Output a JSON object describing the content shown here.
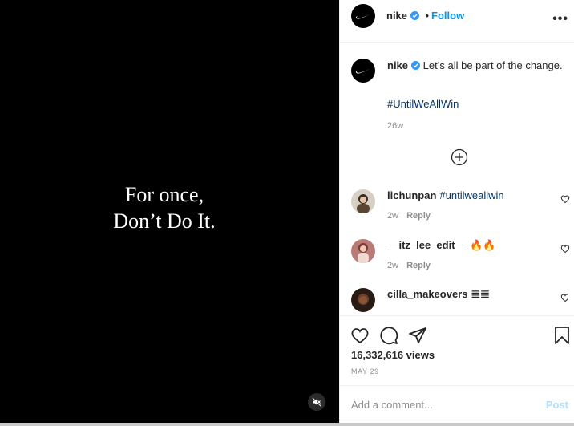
{
  "video": {
    "text_line1": "For once,",
    "text_line2": "Don’t Do It.",
    "mute_icon": "speaker-muted-icon"
  },
  "header": {
    "username": "nike",
    "separator": "•",
    "follow_label": "Follow",
    "more_icon": "more-options-icon",
    "verified_color": "#3897f0"
  },
  "caption": {
    "username": "nike",
    "text": "Let’s all be part of the change.",
    "hashtag": "#UntilWeAllWin",
    "time": "26w",
    "load_more_icon": "plus-circle-icon"
  },
  "comments": [
    {
      "username": "lichunpan",
      "text": "#untilweallwin",
      "time": "2w",
      "reply": "Reply"
    },
    {
      "username": "__itz_lee_edit__",
      "text": "🔥🔥",
      "time": "2w",
      "reply": "Reply"
    },
    {
      "username": "cilla_makeovers",
      "text": "𝌆𝌆",
      "time": "",
      "reply": ""
    }
  ],
  "actions": {
    "like_icon": "heart-icon",
    "comment_icon": "comment-icon",
    "share_icon": "paper-plane-icon",
    "save_icon": "bookmark-icon",
    "views": "16,332,616 views",
    "date": "MAY 29"
  },
  "add_comment": {
    "placeholder": "Add a comment...",
    "post_label": "Post"
  },
  "colors": {
    "link_blue": "#0095f6",
    "hashtag_blue": "#00376b",
    "post_disabled": "#b2dffc"
  }
}
